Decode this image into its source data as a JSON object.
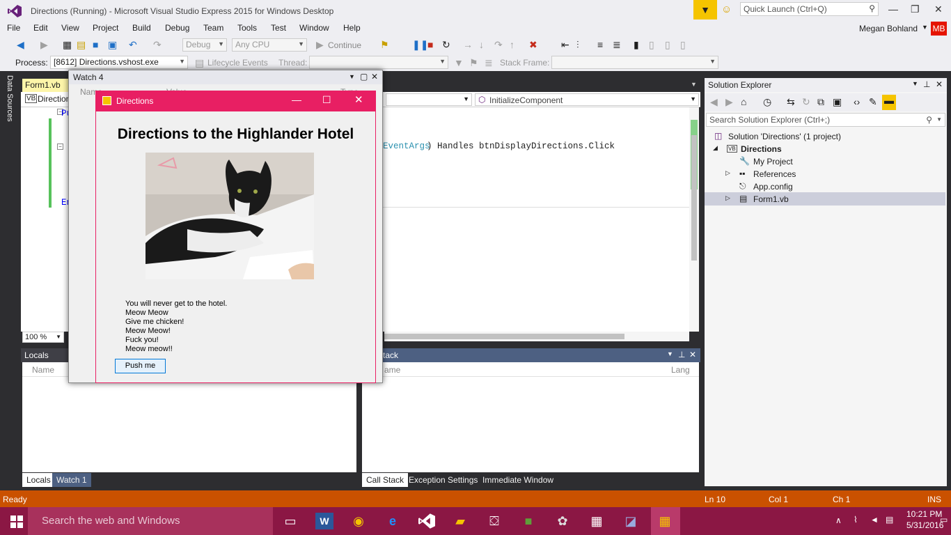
{
  "title_bar": {
    "title": "Directions (Running) - Microsoft Visual Studio Express 2015 for Windows Desktop",
    "quick_launch_placeholder": "Quick Launch (Ctrl+Q)"
  },
  "menu": [
    "File",
    "Edit",
    "View",
    "Project",
    "Build",
    "Debug",
    "Team",
    "Tools",
    "Test",
    "Window",
    "Help"
  ],
  "user": {
    "name": "Megan Bohland",
    "initials": "MB"
  },
  "toolbar": {
    "config": "Debug",
    "platform": "Any CPU",
    "continue": "Continue",
    "process_label": "Process:",
    "process_value": "[8612] Directions.vshost.exe",
    "lifecycle": "Lifecycle Events",
    "thread_label": "Thread:",
    "stack_frame_label": "Stack Frame:"
  },
  "side_tab": "Data Sources",
  "editor": {
    "file_tab": "Form1.vb",
    "nav_left": "Direction",
    "nav_right": "InitializeComponent",
    "zoom": "100 %",
    "code_tail_type": "EventArgs",
    "code_tail_rest": ") Handles btnDisplayDirections.Click",
    "gutter_p": "Pu",
    "gutter_e": "En"
  },
  "watch": {
    "title": "Watch 4",
    "col_name": "Name",
    "col_value": "Value",
    "col_type": "Type"
  },
  "locals": {
    "title": "Locals",
    "col_name": "Name",
    "tab_locals": "Locals",
    "tab_watch": "Watch 1"
  },
  "callstack": {
    "title": "tack",
    "col_name": "ame",
    "col_lang": "Lang",
    "tab1": "Call Stack",
    "tab2": "Exception Settings",
    "tab3": "Immediate Window"
  },
  "solution_explorer": {
    "title": "Solution Explorer",
    "search_placeholder": "Search Solution Explorer (Ctrl+;)",
    "items": [
      "Solution 'Directions' (1 project)",
      "Directions",
      "My Project",
      "References",
      "App.config",
      "Form1.vb"
    ]
  },
  "status": {
    "ready": "Ready",
    "ln": "Ln 10",
    "col": "Col 1",
    "ch": "Ch 1",
    "ins": "INS"
  },
  "taskbar": {
    "search": "Search the web and Windows",
    "time": "10:21 PM",
    "date": "5/31/2016"
  },
  "form": {
    "title": "Directions",
    "heading": "Directions to the Highlander Hotel",
    "lines": [
      "You will never get to the hotel.",
      "Meow Meow",
      "Give me chicken!",
      "Meow Meow!",
      "Fuck you!",
      "Meow meow!!"
    ],
    "button": "Push me"
  }
}
